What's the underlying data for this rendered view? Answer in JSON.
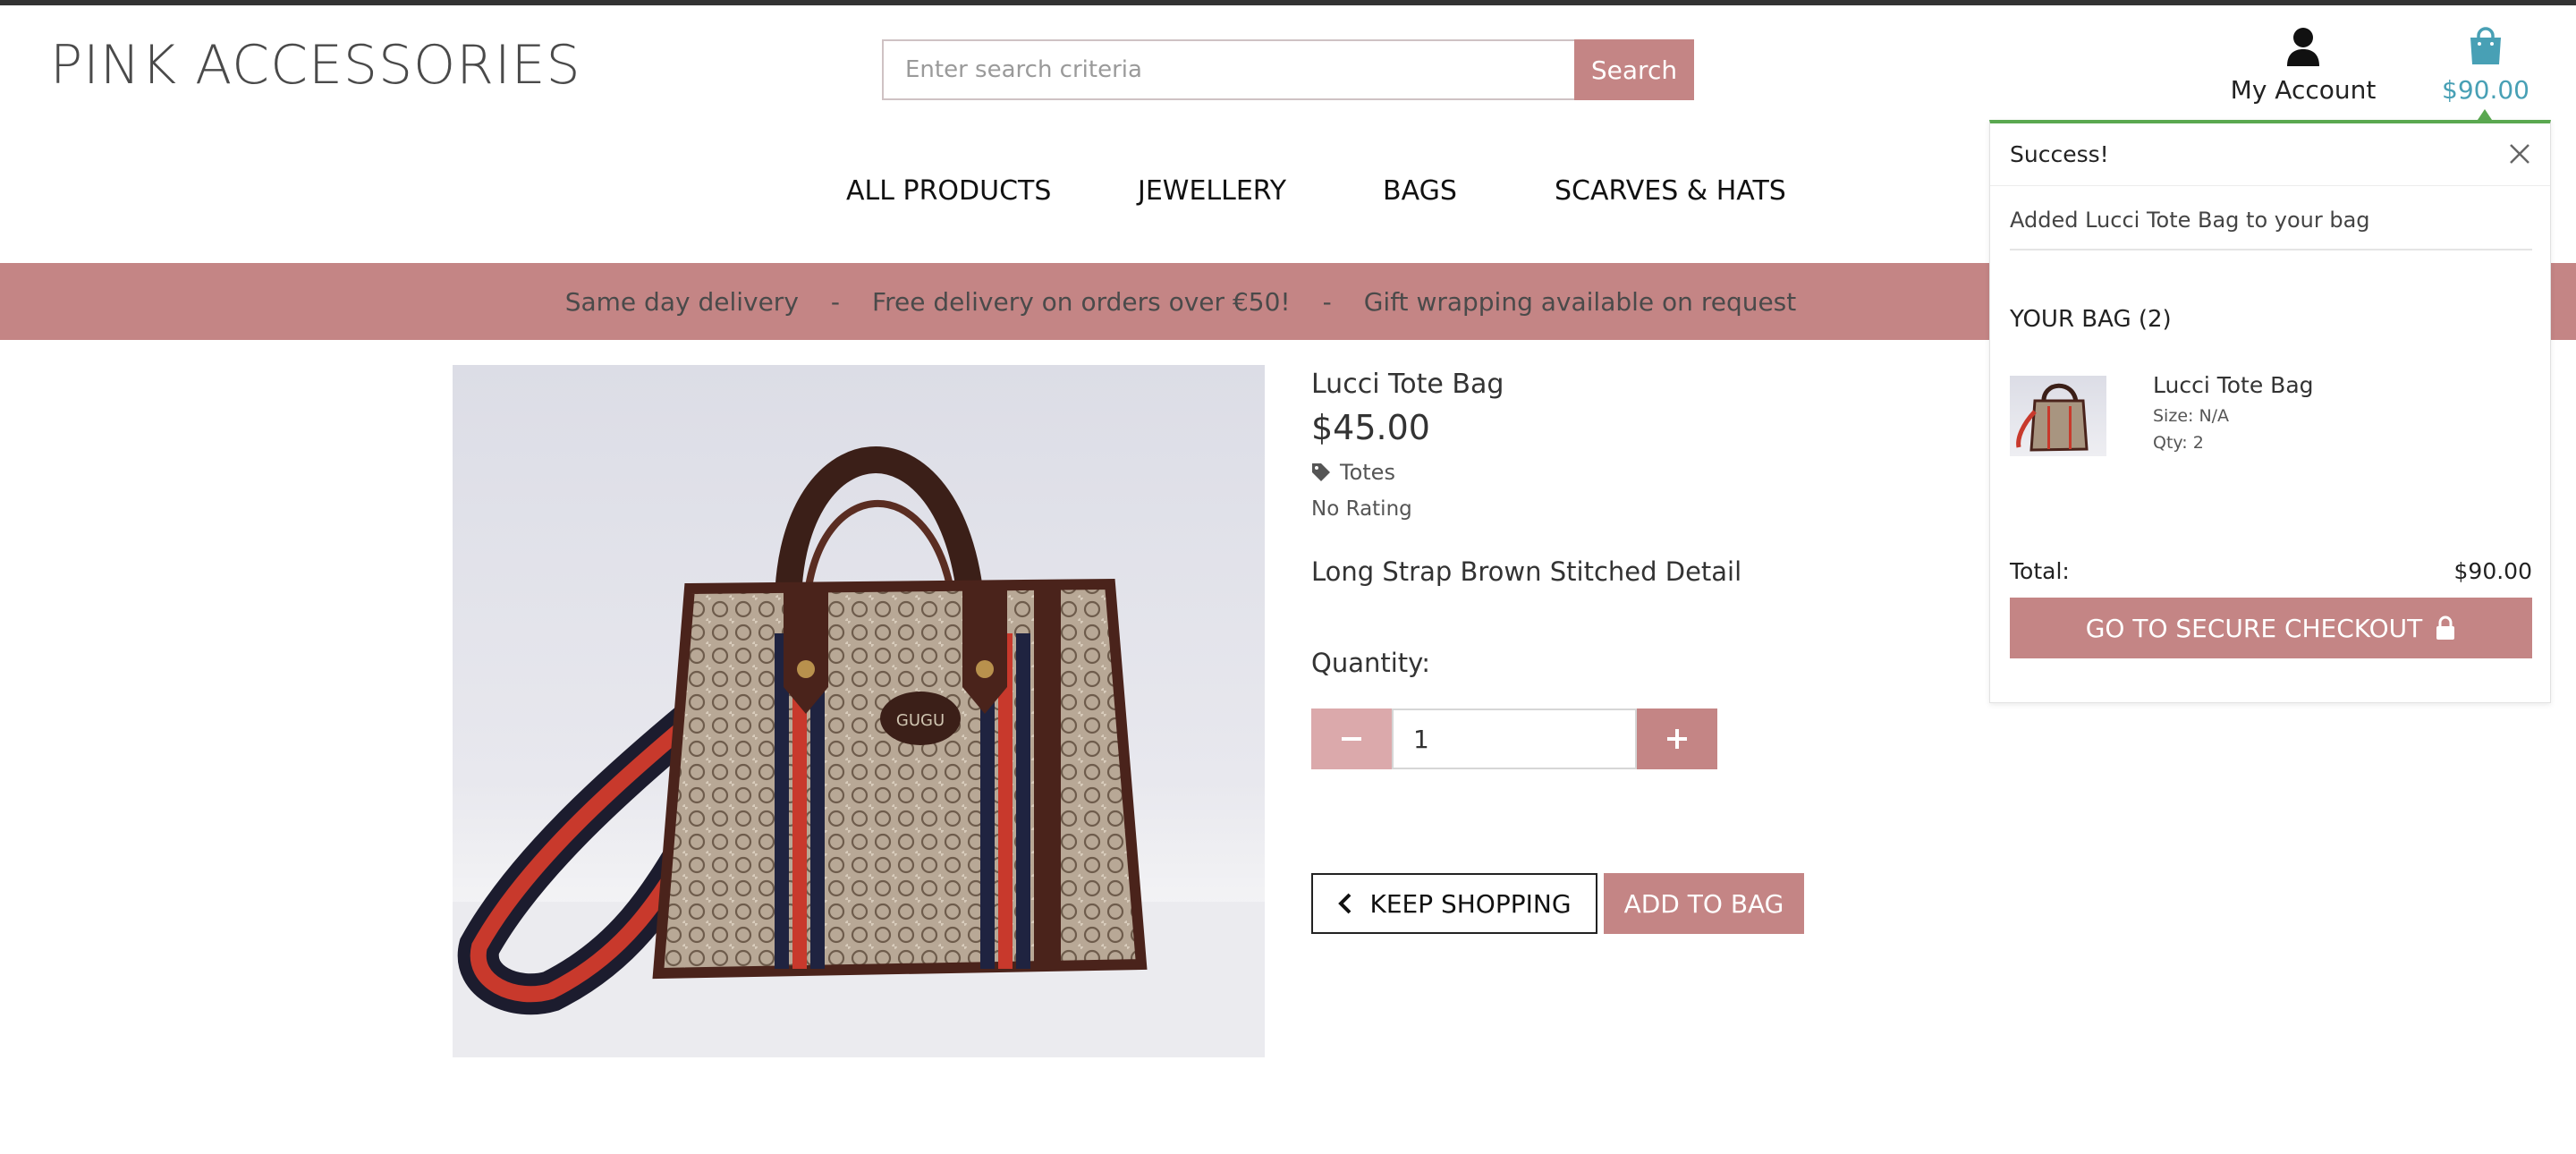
{
  "header": {
    "logo": "PINK ACCESSORIES",
    "search": {
      "placeholder": "Enter search criteria",
      "button_label": "Search"
    },
    "account_label": "My Account",
    "bag_total": "$90.00"
  },
  "nav": {
    "items": [
      {
        "label": "ALL PRODUCTS"
      },
      {
        "label": "JEWELLERY"
      },
      {
        "label": "BAGS"
      },
      {
        "label": "SCARVES & HATS"
      }
    ]
  },
  "banner": {
    "items": [
      "Same day delivery",
      "-",
      "Free delivery on orders over €50!",
      "-",
      "Gift wrapping available on request"
    ]
  },
  "product": {
    "name": "Lucci Tote Bag",
    "price": "$45.00",
    "category": "Totes",
    "rating": "No Rating",
    "description": "Long Strap Brown Stitched Detail",
    "quantity_label": "Quantity:",
    "quantity_value": "1",
    "keep_shopping_label": "KEEP SHOPPING",
    "add_to_bag_label": "ADD TO BAG",
    "image_logo_text": "GUGU"
  },
  "toast": {
    "title": "Success!",
    "message": "Added Lucci Tote Bag to your bag",
    "bag_heading": "YOUR BAG (2)",
    "item": {
      "name": "Lucci Tote Bag",
      "size": "Size: N/A",
      "qty": "Qty: 2"
    },
    "total_label": "Total:",
    "total_value": "$90.00",
    "checkout_label": "GO TO SECURE CHECKOUT"
  },
  "colors": {
    "brand_pink": "#c48585",
    "light_pink": "#dba9ab",
    "bag_total_teal": "#48a0b5",
    "success_green": "#5aa850"
  },
  "icons": [
    "user-icon",
    "shopping-bag-icon",
    "tag-icon",
    "minus-icon",
    "plus-icon",
    "chevron-left-icon",
    "close-icon",
    "lock-icon"
  ]
}
